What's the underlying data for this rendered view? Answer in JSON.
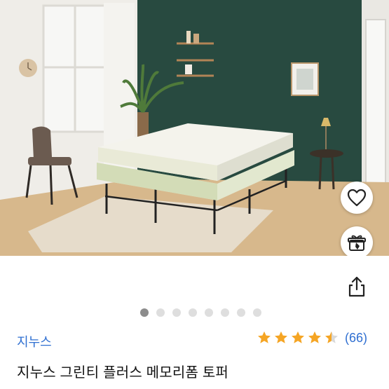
{
  "product": {
    "brand": "지누스",
    "title": "지누스 그린티 플러스 메모리폼 토퍼",
    "rating": 4.5,
    "review_count": "(66)"
  },
  "gallery": {
    "total": 8,
    "active_index": 0
  },
  "colors": {
    "accent": "#2f6fd1",
    "star": "#f5a524",
    "dot_active": "#8c8c8c",
    "dot_inactive": "#dedede"
  },
  "icons": {
    "like": "heart-icon",
    "gift": "gift-icon",
    "share": "share-icon"
  }
}
